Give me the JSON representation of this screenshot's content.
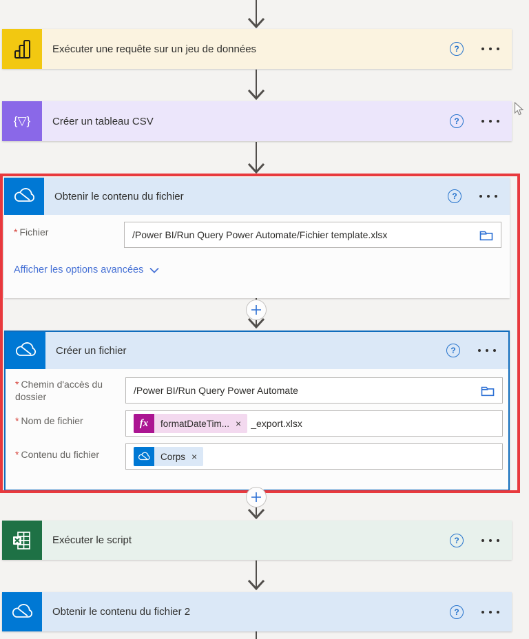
{
  "app": "Power Automate flow designer",
  "glyphs": {
    "help": "?",
    "close": "×",
    "required": "*",
    "csv_icon": "{▽}",
    "fx": "fx"
  },
  "colors": {
    "canvas_bg": "#f4f3f1",
    "powerbi_brand": "#f2c811",
    "powerbi_tint": "#fbf3e0",
    "dataoperation_brand": "#8a68e8",
    "dataoperation_tint": "#ece6fb",
    "onedrive_brand": "#0078d4",
    "onedrive_tint": "#dbe8f7",
    "excel_brand": "#1e7145",
    "excel_tint": "#e8f1ec",
    "group_outline": "#e8393d",
    "selection_border": "#0f6cbd",
    "expression_chip": "#ab1592",
    "link_blue": "#4671d5"
  },
  "nodes": {
    "run_query": {
      "title": "Exécuter une requête sur un jeu de données"
    },
    "create_csv": {
      "title": "Créer un tableau CSV"
    },
    "get_file": {
      "title": "Obtenir le contenu du fichier",
      "file_label": "Fichier",
      "file_value": "/Power BI/Run Query Power Automate/Fichier template.xlsx",
      "advanced_link": "Afficher les options avancées"
    },
    "create_file": {
      "title": "Créer un fichier",
      "folder_label": "Chemin d'accès du dossier",
      "folder_value": "/Power BI/Run Query Power Automate",
      "filename_label": "Nom de fichier",
      "filename_expression": "formatDateTim...",
      "filename_suffix": "_export.xlsx",
      "content_label": "Contenu du fichier",
      "content_chip": "Corps"
    },
    "run_script": {
      "title": "Exécuter le script"
    },
    "get_file2": {
      "title": "Obtenir le contenu du fichier 2"
    }
  }
}
